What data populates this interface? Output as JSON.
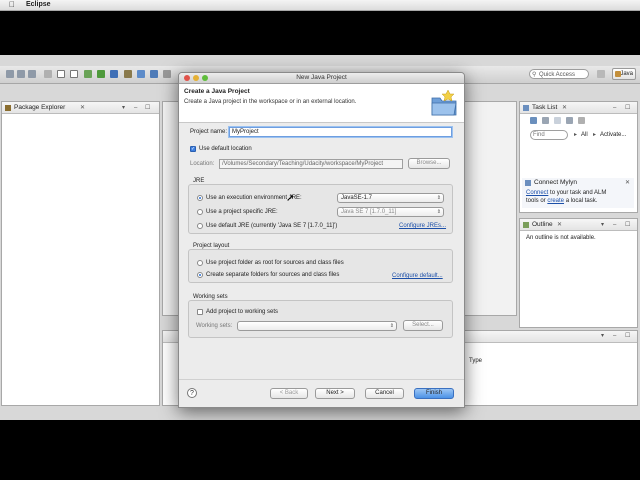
{
  "menubar": {
    "app_name": "Eclipse",
    "apple_icon": "apple-logo-icon"
  },
  "toolbar": {
    "quick_access_placeholder": "Quick Access",
    "java_label": "Java"
  },
  "package_explorer": {
    "title": "Package Explorer"
  },
  "task_list": {
    "title": "Task List",
    "find_placeholder": "Find",
    "all_label": "All",
    "activate_label": "Activate..."
  },
  "connect_mylyn": {
    "title": "Connect Mylyn",
    "line1_link": "Connect",
    "line1_rest": " to your task and ALM",
    "line2_prefix": "tools or ",
    "line2_link": "create",
    "line2_rest": " a local task."
  },
  "outline": {
    "title": "Outline",
    "message": "An outline is not available."
  },
  "bottom_panel": {
    "column_type": "Type"
  },
  "dialog": {
    "window_title": "New Java Project",
    "heading": "Create a Java Project",
    "subtitle": "Create a Java project in the workspace or in an external location.",
    "project_name_label": "Project name:",
    "project_name_value": "MyProject",
    "use_default_location_label": "Use default location",
    "location_label": "Location:",
    "location_value": "/Volumes/Secondary/Teaching/Udacity/workspace/MyProject",
    "browse_label": "Browse...",
    "jre": {
      "group_title": "JRE",
      "exec_env_label": "Use an execution environment JRE:",
      "exec_env_value": "JavaSE-1.7",
      "specific_label": "Use a project specific JRE:",
      "specific_value": "Java SE 7 [1.7.0_11]",
      "default_label": "Use default JRE (currently 'Java SE 7 [1.7.0_11]')",
      "configure_link": "Configure JREs..."
    },
    "layout": {
      "group_title": "Project layout",
      "root_label": "Use project folder as root for sources and class files",
      "separate_label": "Create separate folders for sources and class files",
      "configure_link": "Configure default..."
    },
    "working_sets": {
      "group_title": "Working sets",
      "add_label": "Add project to working sets",
      "sets_label": "Working sets:",
      "select_label": "Select..."
    },
    "buttons": {
      "back": "< Back",
      "next": "Next >",
      "cancel": "Cancel",
      "finish": "Finish"
    }
  },
  "colors": {
    "accent": "#4c92e6",
    "link": "#1c4fa8"
  }
}
